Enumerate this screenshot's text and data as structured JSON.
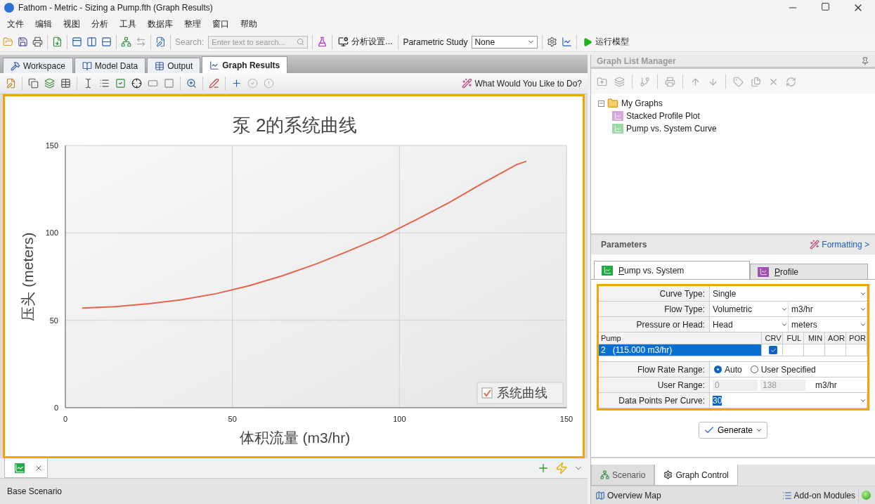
{
  "window": {
    "title": "Fathom - Metric - Sizing a Pump.fth (Graph Results)"
  },
  "menu": [
    "文件",
    "编辑",
    "视图",
    "分析",
    "工具",
    "数据库",
    "整理",
    "窗口",
    "帮助"
  ],
  "toolbar": {
    "search_label": "Search:",
    "search_placeholder": "Enter text to search...",
    "analysis_button": "分析设置...",
    "parametric_label": "Parametric Study",
    "parametric_value": "None",
    "run_button": "运行模型"
  },
  "main_tabs": [
    {
      "label": "Workspace",
      "selected": false
    },
    {
      "label": "Model Data",
      "selected": false
    },
    {
      "label": "Output",
      "selected": false
    },
    {
      "label": "Graph Results",
      "selected": true
    }
  ],
  "graph_toolbar": {
    "help_link": "What Would You Like to Do?"
  },
  "chart": {
    "legend": {
      "checked": true
    },
    "chart_data": {
      "type": "line",
      "title": "泵 2的系统曲线",
      "xlabel": "体积流量 (m3/hr)",
      "ylabel": "压头 (meters)",
      "x": [
        5,
        15,
        25,
        35,
        45,
        55,
        65,
        75,
        85,
        95,
        105,
        115,
        125,
        135,
        138
      ],
      "series": [
        {
          "name": "系统曲线",
          "color": "#e0654a",
          "values": [
            57,
            57.8,
            59.5,
            61.8,
            65.2,
            69.8,
            75.5,
            82.2,
            89.8,
            98,
            107.5,
            117.5,
            128.5,
            139,
            141
          ]
        }
      ],
      "grid": true,
      "xlim": [
        0,
        150
      ],
      "ylim": [
        0,
        150
      ],
      "xticks": [
        0,
        50,
        100,
        150
      ],
      "yticks": [
        0,
        50,
        100,
        150
      ]
    }
  },
  "status_bar": {
    "text": "Base Scenario"
  },
  "graph_list": {
    "title": "Graph List Manager",
    "tree": [
      {
        "label": "My Graphs",
        "expanded": true,
        "children": [
          {
            "label": "Stacked Profile Plot",
            "color": "#d6a6d6"
          },
          {
            "label": "Pump vs. System Curve",
            "color": "#9ad8a6"
          }
        ]
      }
    ]
  },
  "parameters": {
    "title": "Parameters",
    "formatting_link": "Formatting >",
    "tabs": [
      {
        "label": "Pump vs. System",
        "selected": true,
        "color": "#22aa44"
      },
      {
        "label": "Profile",
        "selected": false,
        "color": "#a050b0"
      }
    ],
    "fields_top": [
      {
        "label": "Curve Type:",
        "values": [
          "Single"
        ]
      },
      {
        "label": "Flow Type:",
        "values": [
          "Volumetric",
          "m3/hr"
        ]
      },
      {
        "label": "Pressure or Head:",
        "values": [
          "Head",
          "meters"
        ]
      }
    ],
    "pump_table": {
      "columns": [
        "Pump",
        "CRV",
        "FUL",
        "MIN",
        "AOR",
        "POR"
      ],
      "rows": [
        {
          "label": "2   (115.000 m3/hr)",
          "selected": true,
          "flags": [
            true,
            false,
            false,
            false,
            false
          ]
        }
      ]
    },
    "fields_bottom": [
      {
        "kind": "radio",
        "label": "Flow Rate Range:",
        "options": [
          {
            "label": "Auto",
            "selected": true
          },
          {
            "label": "User Specified",
            "selected": false
          }
        ]
      },
      {
        "kind": "range",
        "label": "User Range:",
        "disabled": true,
        "values": [
          "0",
          "138"
        ],
        "unit": "m3/hr"
      },
      {
        "kind": "select",
        "label": "Data Points Per Curve:",
        "values": [
          "30"
        ],
        "highlighted": true
      }
    ]
  },
  "generate_button": "Generate",
  "side_tabs": [
    {
      "label": "Scenario",
      "selected": false
    },
    {
      "label": "Graph Control",
      "selected": true
    }
  ],
  "footer": {
    "overview": "Overview Map",
    "addons": "Add-on Modules"
  }
}
